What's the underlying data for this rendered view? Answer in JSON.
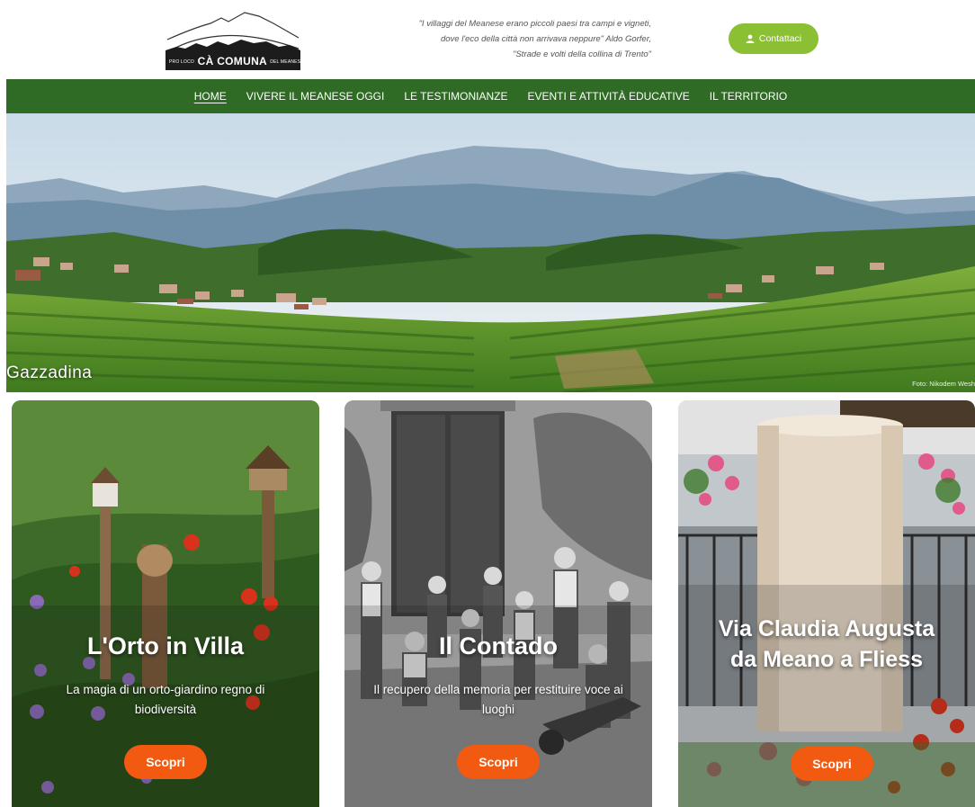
{
  "header": {
    "logo": {
      "prefix": "PRO LOCO",
      "name": "CÀ COMUNA",
      "suffix": "DEL MEANESE"
    },
    "quote": {
      "line1": "\"I villaggi del Meanese erano piccoli paesi tra campi e vigneti,",
      "line2": "dove l'eco della città non arrivava neppure\" Aldo Gorfer,",
      "line3": "\"Strade e volti della collina di Trento\""
    },
    "contact_button": {
      "label": "Contattaci",
      "icon": "user-icon",
      "color": "#8bbf34"
    }
  },
  "nav": {
    "color": "#2f6b25",
    "items": [
      {
        "label": "HOME",
        "active": true
      },
      {
        "label": "VIVERE IL MEANESE OGGI",
        "active": false
      },
      {
        "label": "LE TESTIMONIANZE",
        "active": false
      },
      {
        "label": "EVENTI E ATTIVITÀ EDUCATIVE",
        "active": false
      },
      {
        "label": "IL TERRITORIO",
        "active": false
      }
    ]
  },
  "hero": {
    "caption": "Gazzadina",
    "credit": "Foto: Nikodem Wesh"
  },
  "cards": [
    {
      "title": "L'Orto in Villa",
      "description": "La magia di un orto-giardino regno di biodiversità",
      "button": "Scopri"
    },
    {
      "title": "Il Contado",
      "description": "Il recupero della memoria per restituire voce ai luoghi",
      "button": "Scopri"
    },
    {
      "title": "Via Claudia Augusta da Meano a Fliess",
      "description": "",
      "button": "Scopri"
    }
  ],
  "accent_color": "#f25a12"
}
